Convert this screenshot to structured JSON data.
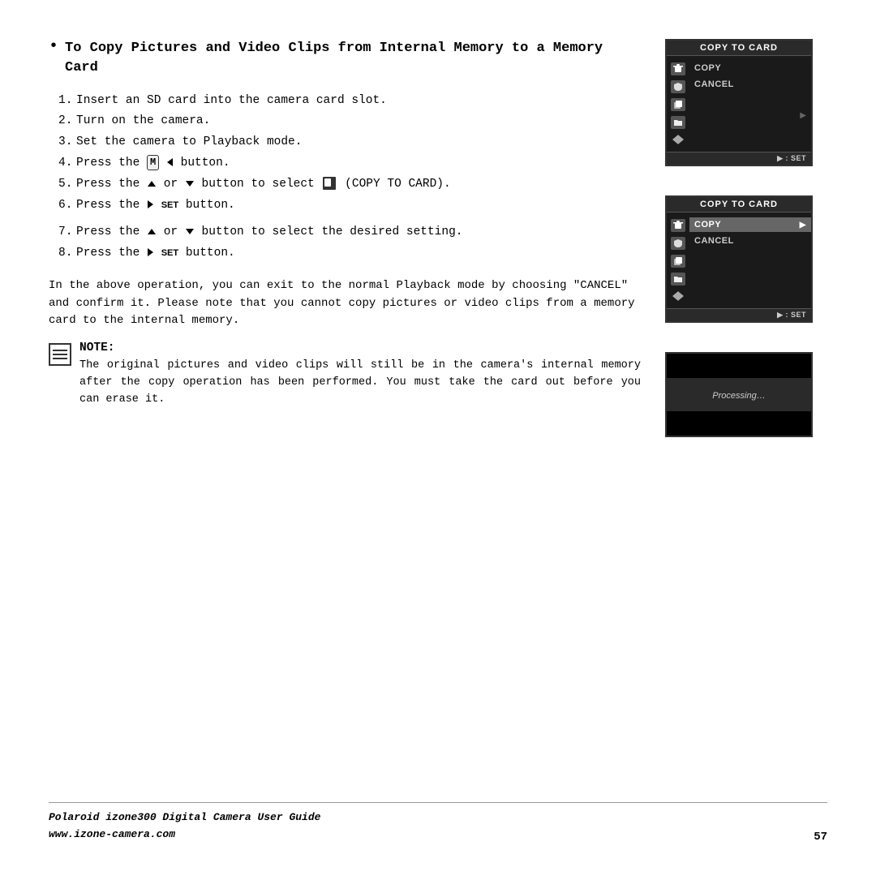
{
  "page": {
    "title": "To Copy Pictures and Video Clips from Internal Memory to a Memory Card",
    "steps": [
      {
        "num": "1.",
        "text": "Insert an SD card into the camera card slot."
      },
      {
        "num": "2.",
        "text": "Turn on the camera."
      },
      {
        "num": "3.",
        "text": "Set the camera to Playback mode."
      },
      {
        "num": "4.",
        "text": "Press the  ◄ button."
      },
      {
        "num": "5.",
        "text": "Press the ▲ or ▼ button to select  (COPY TO CARD)."
      },
      {
        "num": "6.",
        "text": "Press the ▶ SET button."
      },
      {
        "num": "7.",
        "text": "Press the ▲ or ▼ button to select the desired setting."
      },
      {
        "num": "8.",
        "text": "Press the ▶ SET button."
      }
    ],
    "paragraph": "In the above operation, you can exit to the normal Playback mode by choosing \"CANCEL\" and confirm it. Please note that you cannot copy pictures or video clips from a memory card to the internal memory.",
    "note_title": "NOTE:",
    "note_body": "The original pictures and video clips will still be in the camera's internal memory after the copy operation has been performed. You must take the card out before you can erase it.",
    "screen1": {
      "title": "COPY TO CARD",
      "menu_copy": "COPY",
      "menu_cancel": "CANCEL",
      "bottom_label": "▶ : SET"
    },
    "screen2": {
      "title": "COPY TO CARD",
      "menu_copy": "COPY",
      "menu_cancel": "CANCEL",
      "bottom_label": "▶ : SET"
    },
    "screen3": {
      "processing_text": "Processing…"
    },
    "footer": {
      "brand": "Polaroid izone300 Digital Camera User Guide",
      "url": "www.izone-camera.com",
      "page_number": "57"
    }
  }
}
